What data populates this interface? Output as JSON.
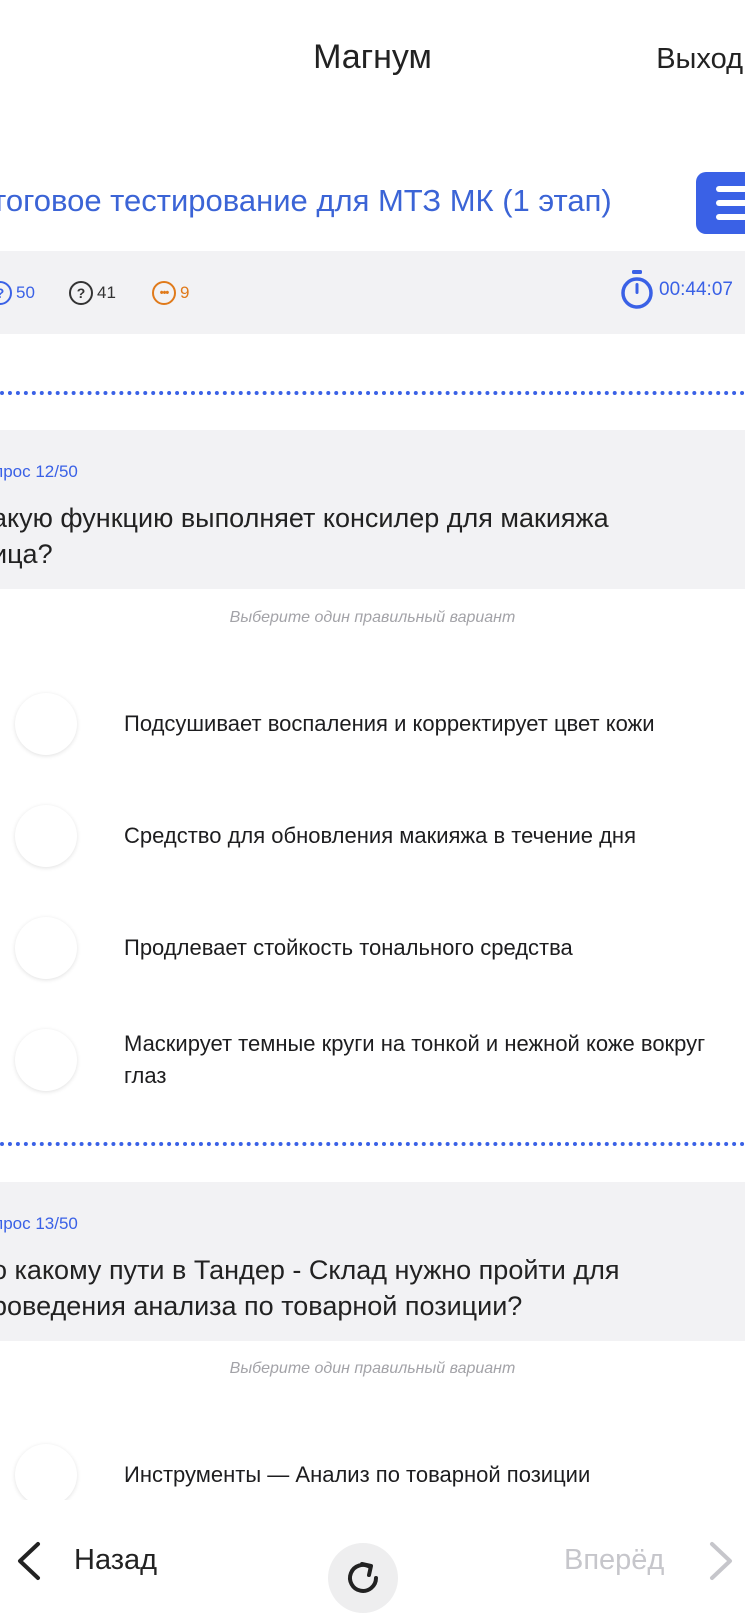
{
  "header": {
    "app_title": "Магнум",
    "logout_label": "Выход"
  },
  "test": {
    "title": "тоговое тестирование для МТЗ МК (1 этап)",
    "stats": {
      "total": "50",
      "unanswered": "41",
      "skipped": "9"
    },
    "timer": "00:44:07"
  },
  "questions": [
    {
      "number": "прос 12/50",
      "text_line1": "акую функцию выполняет консилер для макияжа",
      "text_line2": "ица?",
      "hint": "Выберите один правильный вариант",
      "options": [
        "Подсушивает воспаления и корректирует цвет кожи",
        "Средство для обновления макияжа в течение дня",
        "Продлевает стойкость тонального средства",
        "Маскирует темные круги на тонкой и нежной коже вокруг глаз"
      ]
    },
    {
      "number": "прос 13/50",
      "text_line1": "о какому пути в Тандер - Склад нужно пройти для",
      "text_line2": "роведения анализа по товарной позиции?",
      "hint": "Выберите один правильный вариант",
      "options": [
        "Инструменты — Анализ по товарной позиции"
      ]
    }
  ],
  "footer": {
    "back_label": "Назад",
    "next_label": "Вперёд"
  },
  "colors": {
    "accent": "#3a61e6",
    "skipped": "#e07a1a",
    "panel_bg": "#f2f2f4"
  }
}
